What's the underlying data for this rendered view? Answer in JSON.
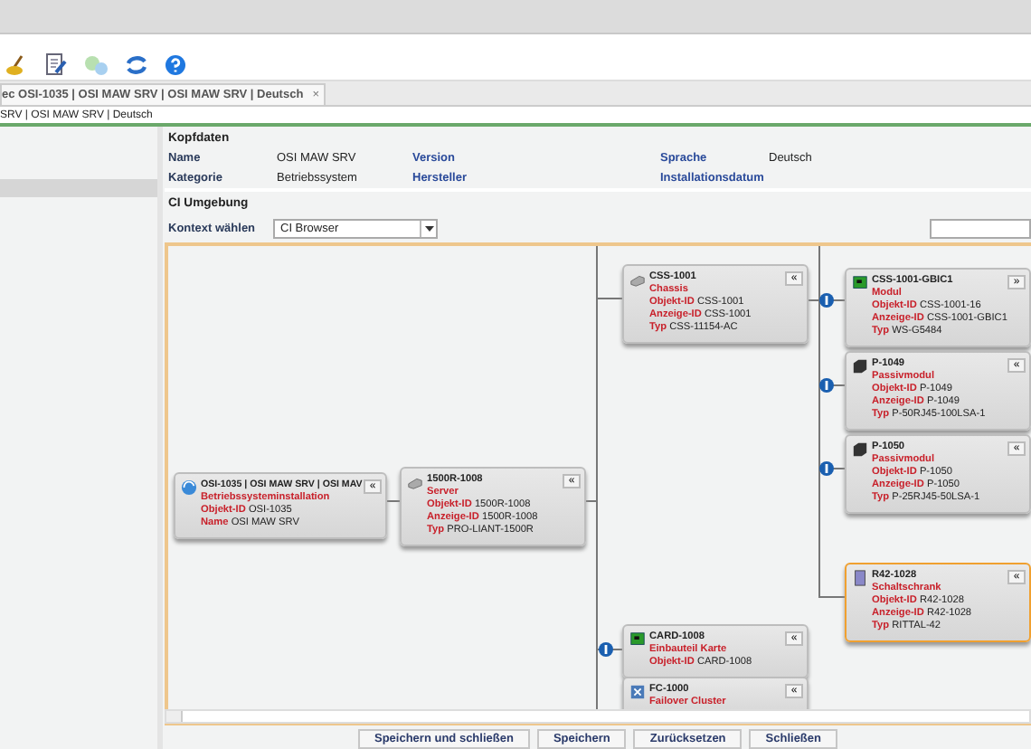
{
  "tab": {
    "label": "ec OSI-1035 | OSI MAW SRV | OSI MAW SRV | Deutsch",
    "close": "×"
  },
  "breadcrumb": "SRV | OSI MAW SRV | Deutsch",
  "kopfdaten": {
    "title": "Kopfdaten",
    "rows": [
      [
        {
          "label": "Name",
          "value": "OSI MAW SRV"
        },
        {
          "label": "Version"
        },
        {
          "label": "Sprache",
          "value": "Deutsch"
        }
      ],
      [
        {
          "label": "Kategorie",
          "value": "Betriebssystem"
        },
        {
          "label": "Hersteller"
        },
        {
          "label": "Installationsdatum"
        }
      ]
    ]
  },
  "ci": {
    "title": "CI Umgebung",
    "context_label": "Kontext wählen",
    "context_value": "CI Browser"
  },
  "nodes": [
    {
      "kind": "os",
      "title": "OSI-1035 | OSI MAW SRV | OSI MAV",
      "type": "Betriebssysteminstallation",
      "fields": [
        {
          "label": "Objekt-ID",
          "value": "OSI-1035"
        },
        {
          "label": "Name",
          "value": "OSI MAW SRV"
        }
      ],
      "toggle": "«",
      "selected": false
    },
    {
      "kind": "server",
      "title": "1500R-1008",
      "type": "Server",
      "fields": [
        {
          "label": "Objekt-ID",
          "value": "1500R-1008"
        },
        {
          "label": "Anzeige-ID",
          "value": "1500R-1008"
        },
        {
          "label": "Typ",
          "value": "PRO-LIANT-1500R"
        }
      ],
      "toggle": "«",
      "selected": false
    },
    {
      "kind": "server",
      "title": "CSS-1001",
      "type": "Chassis",
      "fields": [
        {
          "label": "Objekt-ID",
          "value": "CSS-1001"
        },
        {
          "label": "Anzeige-ID",
          "value": "CSS-1001"
        },
        {
          "label": "Typ",
          "value": "CSS-11154-AC"
        }
      ],
      "toggle": "«",
      "selected": false
    },
    {
      "kind": "card",
      "title": "CSS-1001-GBIC1",
      "type": "Modul",
      "fields": [
        {
          "label": "Objekt-ID",
          "value": "CSS-1001-16"
        },
        {
          "label": "Anzeige-ID",
          "value": "CSS-1001-GBIC1"
        },
        {
          "label": "Typ",
          "value": "WS-G5484"
        }
      ],
      "toggle": "»",
      "selected": false
    },
    {
      "kind": "passive",
      "title": "P-1049",
      "type": "Passivmodul",
      "fields": [
        {
          "label": "Objekt-ID",
          "value": "P-1049"
        },
        {
          "label": "Anzeige-ID",
          "value": "P-1049"
        },
        {
          "label": "Typ",
          "value": "P-50RJ45-100LSA-1"
        }
      ],
      "toggle": "«",
      "selected": false
    },
    {
      "kind": "passive",
      "title": "P-1050",
      "type": "Passivmodul",
      "fields": [
        {
          "label": "Objekt-ID",
          "value": "P-1050"
        },
        {
          "label": "Anzeige-ID",
          "value": "P-1050"
        },
        {
          "label": "Typ",
          "value": "P-25RJ45-50LSA-1"
        }
      ],
      "toggle": "«",
      "selected": false
    },
    {
      "kind": "rack",
      "title": "R42-1028",
      "type": "Schaltschrank",
      "fields": [
        {
          "label": "Objekt-ID",
          "value": "R42-1028"
        },
        {
          "label": "Anzeige-ID",
          "value": "R42-1028"
        },
        {
          "label": "Typ",
          "value": "RITTAL-42"
        }
      ],
      "toggle": "«",
      "selected": true
    },
    {
      "kind": "card",
      "title": "CARD-1008",
      "type": "Einbauteil Karte",
      "fields": [
        {
          "label": "Objekt-ID",
          "value": "CARD-1008"
        }
      ],
      "toggle": "«",
      "selected": false
    },
    {
      "kind": "cluster",
      "title": "FC-1000",
      "type": "Failover Cluster",
      "toggle": "«",
      "selected": false
    }
  ],
  "buttons": [
    "Speichern und schließen",
    "Speichern",
    "Zurücksetzen",
    "Schließen"
  ]
}
